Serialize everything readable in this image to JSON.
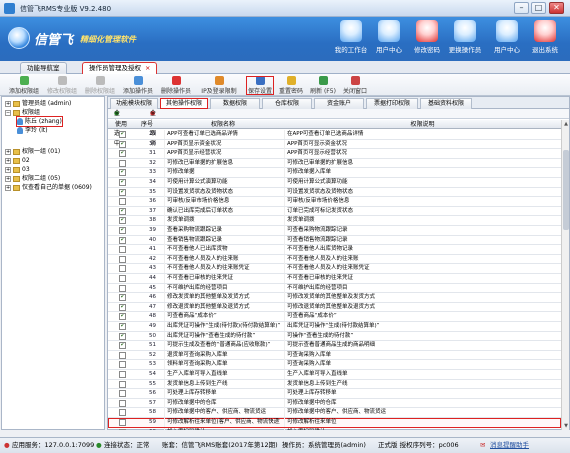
{
  "window": {
    "title": "信管飞RMS专业版 V9.2.480",
    "min": "–",
    "max": "□",
    "close": "✕"
  },
  "banner": {
    "logo": "信管飞",
    "subtitle": "精细化管理软件",
    "nav": [
      {
        "label": "我的工作台"
      },
      {
        "label": "用户中心"
      },
      {
        "label": "修改密码"
      },
      {
        "label": "更换操作员"
      },
      {
        "label": "用户中心"
      },
      {
        "label": "退出系统"
      }
    ]
  },
  "tabs": [
    {
      "label": "功能导航室"
    },
    {
      "label": "操作员管理及授权",
      "close": "×"
    }
  ],
  "toolbar": [
    {
      "label": "添加权限组",
      "disabled": false
    },
    {
      "label": "修改权限组",
      "disabled": true
    },
    {
      "label": "删除权限组",
      "disabled": true
    },
    {
      "label": "添加操作员",
      "disabled": false
    },
    {
      "label": "删除操作员",
      "disabled": false
    },
    {
      "label": "IP及登录限制",
      "disabled": false
    },
    {
      "label": "保存设置",
      "disabled": false
    },
    {
      "label": "重置密码",
      "disabled": false
    },
    {
      "label": "刷新 (F5)",
      "disabled": false
    },
    {
      "label": "关闭窗口",
      "disabled": false
    }
  ],
  "tree": [
    {
      "label": "管理员组 (admin)",
      "expand": "+",
      "indent": 0,
      "type": "folder"
    },
    {
      "label": "权限组",
      "expand": "−",
      "indent": 0,
      "type": "folder"
    },
    {
      "label": "陈丘 (zhang)",
      "indent": 1,
      "type": "user",
      "selected": true
    },
    {
      "label": "李玲 (lt)",
      "indent": 1,
      "type": "user"
    },
    {
      "label": "权限一组 (01)",
      "expand": "+",
      "indent": 0,
      "type": "folder"
    },
    {
      "label": "02",
      "expand": "+",
      "indent": 0,
      "type": "folder"
    },
    {
      "label": "03",
      "expand": "+",
      "indent": 0,
      "type": "folder"
    },
    {
      "label": "权限二组 (05)",
      "expand": "+",
      "indent": 0,
      "type": "folder"
    },
    {
      "label": "仅查看自己的单据 (0609)",
      "expand": "+",
      "indent": 0,
      "type": "folder"
    }
  ],
  "subtabs": [
    "功能模块权限",
    "其他操作权限",
    "数据权限",
    "仓库权限",
    "资金账户",
    "票据打印权限",
    "基础资料权限"
  ],
  "selectors": {
    "all": "全部选中",
    "none": "全部取消"
  },
  "columns": {
    "use": "使用",
    "seq": "序号",
    "name": "权限名称",
    "desc": "权限说明"
  },
  "rows": [
    {
      "n": "29",
      "on": true,
      "name": "APP可查看订单已选商品详情",
      "desc": "在APP可查看订单已选商品详情"
    },
    {
      "n": "30",
      "on": true,
      "name": "APP首页显示资金状况",
      "desc": "APP首页可显示资金状况"
    },
    {
      "n": "31",
      "on": true,
      "name": "APP首页显示经营状况",
      "desc": "APP首页可显示经营状况"
    },
    {
      "n": "32",
      "on": false,
      "name": "可修改已审单据的扩展信息",
      "desc": "可修改已审单据的扩展信息"
    },
    {
      "n": "33",
      "on": true,
      "name": "可修改单据",
      "desc": "可修改单据入库单"
    },
    {
      "n": "34",
      "on": true,
      "name": "可使用计算公式演算功能",
      "desc": "可使用计算公式演算功能"
    },
    {
      "n": "35",
      "on": true,
      "name": "可设置发货状态及货物状态",
      "desc": "可设置发货状态及货物状态"
    },
    {
      "n": "36",
      "on": false,
      "name": "可审核/反审市场价格信息",
      "desc": "可审核/反审市场价格信息"
    },
    {
      "n": "37",
      "on": true,
      "name": "确认已出库完成后订单状态",
      "desc": "订单已完成可标记发货状态"
    },
    {
      "n": "38",
      "on": true,
      "name": "发货单调拨",
      "desc": "发货单调拨"
    },
    {
      "n": "39",
      "on": true,
      "name": "查看采购物流跟踪记录",
      "desc": "可查看采购物流跟踪记录"
    },
    {
      "n": "40",
      "on": true,
      "name": "查看销售物流跟踪记录",
      "desc": "可查看销售物流跟踪记录"
    },
    {
      "n": "41",
      "on": false,
      "name": "不可查看他人已出库货物",
      "desc": "不可查看他人出库货物记录"
    },
    {
      "n": "42",
      "on": false,
      "name": "不可查看他人员及人的往来账",
      "desc": "不可查看他人员及人的往来账"
    },
    {
      "n": "43",
      "on": false,
      "name": "不可查看他人员及人的往来账凭证",
      "desc": "不可查看他人员及人的往来账凭证"
    },
    {
      "n": "44",
      "on": false,
      "name": "不可查看已审核的往来凭证",
      "desc": "不可查看已审核的往来凭证"
    },
    {
      "n": "45",
      "on": false,
      "name": "不可维护出库的经营项目",
      "desc": "不可维护出库的经营项目"
    },
    {
      "n": "46",
      "on": true,
      "name": "修改发货单的其他整单及发货方式",
      "desc": "可修改发货单的其他整单及发货方式"
    },
    {
      "n": "47",
      "on": true,
      "name": "修改退货单的其他整单及退货方式",
      "desc": "可修改退货单的其他整单及退货方式"
    },
    {
      "n": "48",
      "on": true,
      "name": "可查看商品“成本价”",
      "desc": "可查看商品“成本价”"
    },
    {
      "n": "49",
      "on": true,
      "name": "出库凭证可操作“生成(待付款)(待付款结算单)”",
      "desc": "出库凭证可操作“生成(待付款结算单)”"
    },
    {
      "n": "50",
      "on": true,
      "name": "出库凭证可操作“查看生成的待付款”",
      "desc": "可操作“查看生成的待付款”"
    },
    {
      "n": "51",
      "on": true,
      "name": "可提示生成及查看的“普通商品(应收账款)”",
      "desc": "可提示查看普通商品生成的商品明细"
    },
    {
      "n": "52",
      "on": false,
      "name": "退货单可查询采购入库单",
      "desc": "可查询采购入库单"
    },
    {
      "n": "53",
      "on": false,
      "name": "领料单可查询采购入库单",
      "desc": "可查询采购入库单"
    },
    {
      "n": "54",
      "on": false,
      "name": "生产入库单可导入直线单",
      "desc": "生产入库单可导入直线单"
    },
    {
      "n": "55",
      "on": false,
      "name": "发货单信息上传到生产线",
      "desc": "发货单信息上传到生产线"
    },
    {
      "n": "56",
      "on": false,
      "name": "可处理上库存转移单",
      "desc": "可处理上库存转移单"
    },
    {
      "n": "57",
      "on": false,
      "name": "可修改单据中的仓库",
      "desc": "可修改单据中的仓库"
    },
    {
      "n": "58",
      "on": false,
      "name": "可修改单据中的客户、供应商、物流货运",
      "desc": "可修改单据中的客户、供应商、物流货运"
    },
    {
      "n": "59",
      "on": false,
      "name": "可修改解析往来单位(客户、供应商、物流快递)",
      "desc": "可修改解析往来单位"
    },
    {
      "n": "60",
      "on": false,
      "name": "加入库扫码确认",
      "desc": "加入库扫码确认"
    }
  ],
  "highlighted_row": "59",
  "statusbar": {
    "server": "应用服务：127.0.0.1:7099",
    "conn": "连接状态：正常",
    "user": "账套：信管飞RMS账套(2017年第12期)",
    "op": "操作员：系统管理员(admin)",
    "version": "正式版 授权序列号：pc006",
    "msg": "消息提醒助手"
  }
}
